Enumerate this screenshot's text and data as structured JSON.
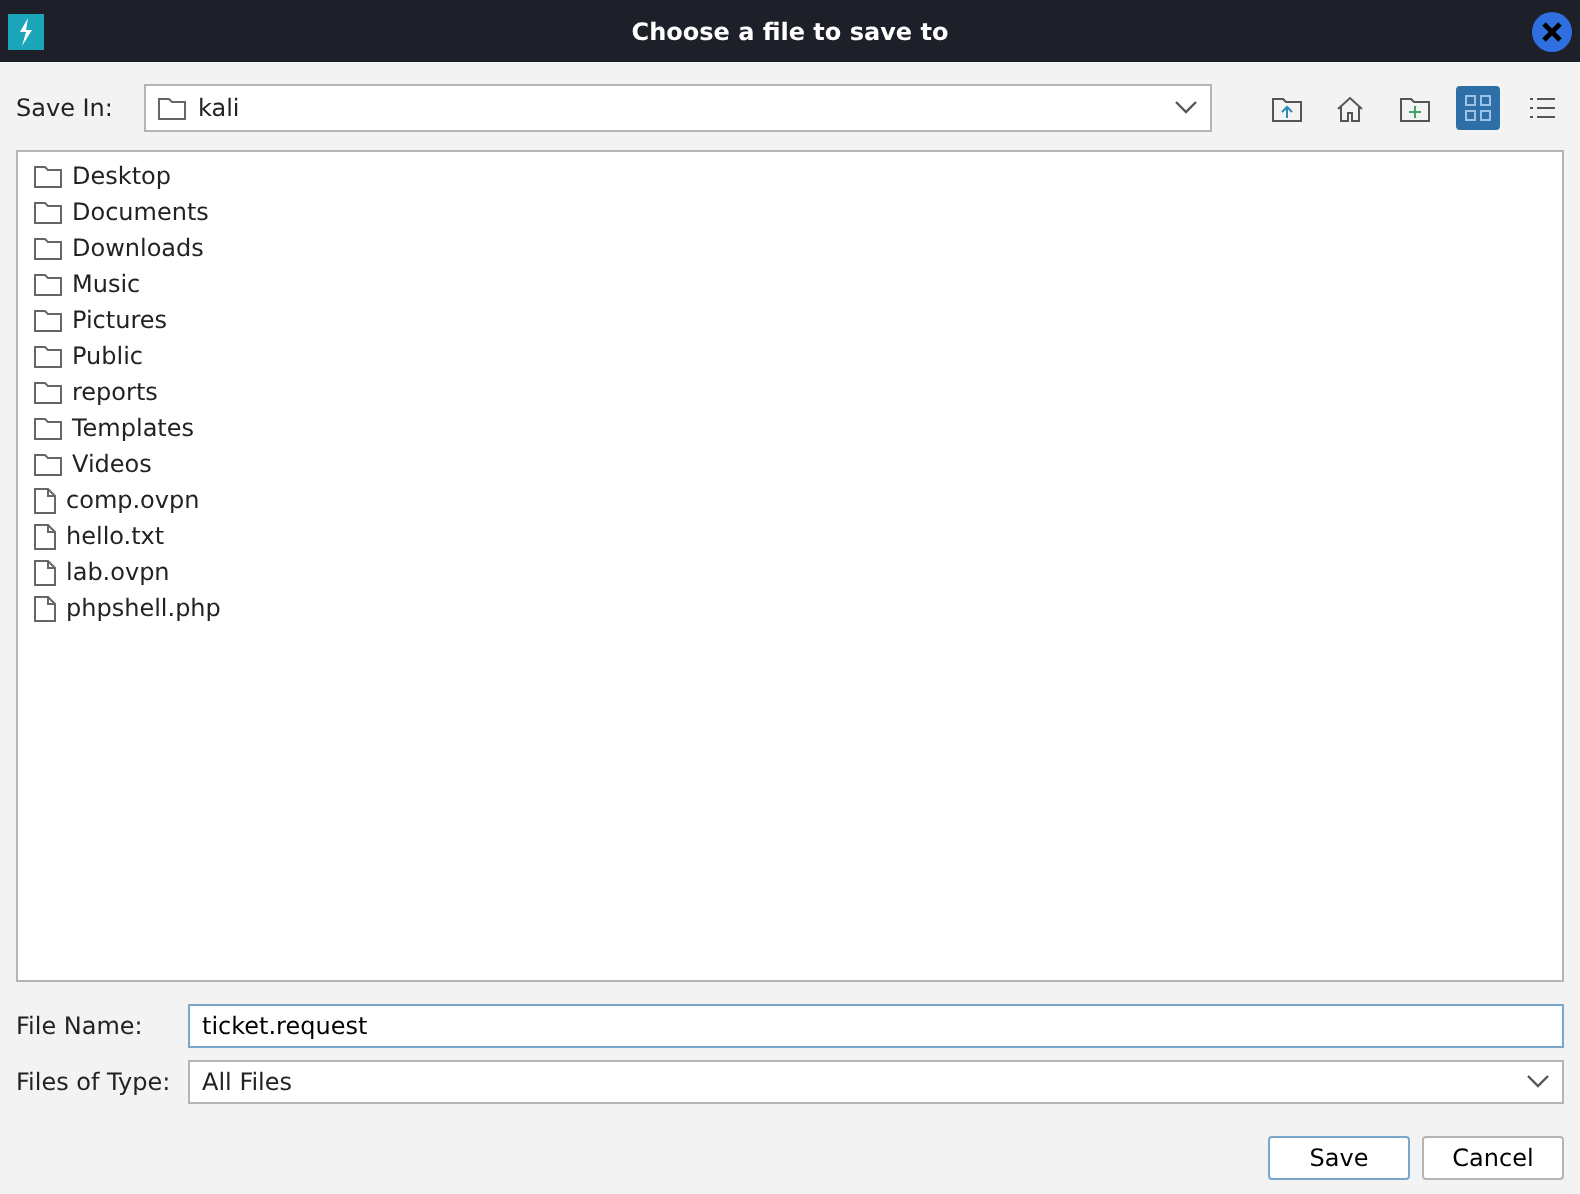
{
  "window": {
    "title": "Choose a file to save to"
  },
  "save_in": {
    "label": "Save In:",
    "value": "kali"
  },
  "toolbar": [
    {
      "kind": "up",
      "selected": false
    },
    {
      "kind": "home",
      "selected": false
    },
    {
      "kind": "newfolder",
      "selected": false
    },
    {
      "kind": "grid",
      "selected": true
    },
    {
      "kind": "list",
      "selected": false
    }
  ],
  "files": [
    {
      "name": "Desktop",
      "kind": "folder"
    },
    {
      "name": "Documents",
      "kind": "folder"
    },
    {
      "name": "Downloads",
      "kind": "folder"
    },
    {
      "name": "Music",
      "kind": "folder"
    },
    {
      "name": "Pictures",
      "kind": "folder"
    },
    {
      "name": "Public",
      "kind": "folder"
    },
    {
      "name": "reports",
      "kind": "folder"
    },
    {
      "name": "Templates",
      "kind": "folder"
    },
    {
      "name": "Videos",
      "kind": "folder"
    },
    {
      "name": "comp.ovpn",
      "kind": "file"
    },
    {
      "name": "hello.txt",
      "kind": "file"
    },
    {
      "name": "lab.ovpn",
      "kind": "file"
    },
    {
      "name": "phpshell.php",
      "kind": "file"
    }
  ],
  "file_name": {
    "label": "File Name:",
    "value": "ticket.request"
  },
  "file_type": {
    "label": "Files of Type:",
    "value": "All Files"
  },
  "buttons": [
    "Save",
    "Cancel"
  ]
}
